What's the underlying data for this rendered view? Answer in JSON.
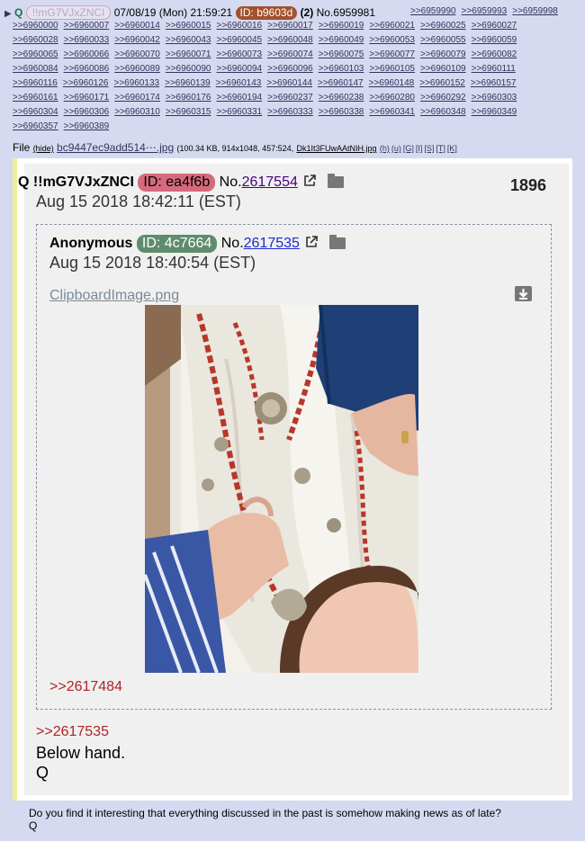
{
  "header": {
    "arrow": "▶",
    "name": "Q",
    "trip": "!!mG7VJxZNCI",
    "datetime": "07/08/19 (Mon) 21:59:21",
    "id_label": "ID: b9603d",
    "id_count": "(2)",
    "post_no": "No.6959981",
    "replies": [
      ">>6959990",
      ">>6959993",
      ">>6959998",
      ">>6960000",
      ">>6960007",
      ">>6960014",
      ">>6960015",
      ">>6960016",
      ">>6960017",
      ">>6960019",
      ">>6960021",
      ">>6960025",
      ">>6960027",
      ">>6960028",
      ">>6960033",
      ">>6960042",
      ">>6960043",
      ">>6960045",
      ">>6960048",
      ">>6960049",
      ">>6960053",
      ">>6960055",
      ">>6960059",
      ">>6960065",
      ">>6960066",
      ">>6960070",
      ">>6960071",
      ">>6960073",
      ">>6960074",
      ">>6960075",
      ">>6960077",
      ">>6960079",
      ">>6960082",
      ">>6960084",
      ">>6960086",
      ">>6960089",
      ">>6960090",
      ">>6960094",
      ">>6960096",
      ">>6960103",
      ">>6960105",
      ">>6960109",
      ">>6960111",
      ">>6960116",
      ">>6960126",
      ">>6960133",
      ">>6960139",
      ">>6960143",
      ">>6960144",
      ">>6960147",
      ">>6960148",
      ">>6960152",
      ">>6960157",
      ">>6960161",
      ">>6960171",
      ">>6960174",
      ">>6960176",
      ">>6960194",
      ">>6960237",
      ">>6960238",
      ">>6960280",
      ">>6960292",
      ">>6960303",
      ">>6960304",
      ">>6960306",
      ">>6960310",
      ">>6960315",
      ">>6960331",
      ">>6960333",
      ">>6960338",
      ">>6960341",
      ">>6960348",
      ">>6960349",
      ">>6960357",
      ">>6960389"
    ]
  },
  "file": {
    "label": "File",
    "hide": "(hide)",
    "filename": "bc9447ec9add514⋯.jpg",
    "meta": "(100.34 KB, 914x1048, 457:524,",
    "orig_name": "Dk1It3FUwAAtNIH.jpg",
    "links": [
      "(h)",
      "(u)",
      "[G]",
      "[I]",
      "[S]",
      "[T]",
      "[K]"
    ]
  },
  "q_post": {
    "name": "Q",
    "trip": "!!mG7VJxZNCI",
    "id_label": "ID: ea4f6b",
    "no_prefix": "No.",
    "no": "2617554",
    "date": "Aug 15 2018 18:42:11 (EST)",
    "count": "1896"
  },
  "quoted": {
    "name": "Anonymous",
    "id_label": "ID: 4c7664",
    "no_prefix": "No.",
    "no": "2617535",
    "date": "Aug 15 2018 18:40:54 (EST)",
    "image_name": "ClipboardImage.png",
    "reply_link": ">>2617484"
  },
  "q_reply_link": ">>2617535",
  "q_message_line1": "Below hand.",
  "q_message_line2": "Q",
  "bottom_line1": "Do you find it interesting that everything discussed in the past is somehow making news as of late?",
  "bottom_line2": "Q"
}
